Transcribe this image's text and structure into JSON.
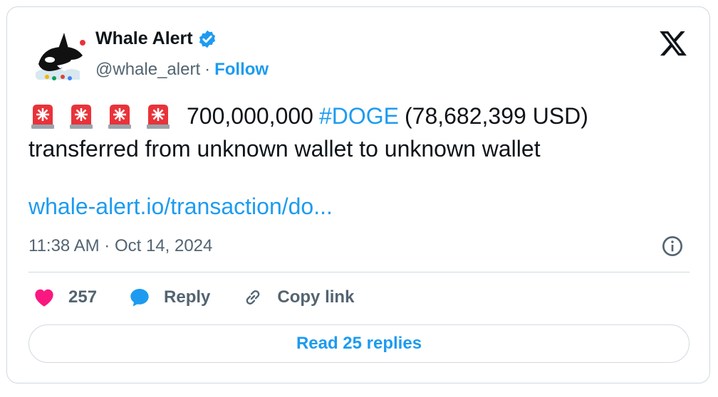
{
  "author": {
    "name": "Whale Alert",
    "handle": "@whale_alert",
    "separator": "·",
    "follow_label": "Follow",
    "avatar_icon": "whale-avatar-icon",
    "verified_icon": "verified-badge-icon"
  },
  "tweet": {
    "siren_icon": "rotating-light-emoji",
    "siren_count": 4,
    "amount": "700,000,000",
    "hashtag": "#DOGE",
    "usd": "(78,682,399 USD)",
    "line2": "transferred from unknown wallet to unknown wallet",
    "link": "whale-alert.io/transaction/do...",
    "timestamp": "11:38 AM · Oct 14, 2024"
  },
  "actions": {
    "like_count": "257",
    "reply_label": "Reply",
    "copy_label": "Copy link"
  },
  "read_replies": "Read 25 replies",
  "colors": {
    "accent": "#1d9bf0",
    "like": "#f91880",
    "text": "#0f1419",
    "muted": "#536471",
    "border": "#cfd9de"
  }
}
